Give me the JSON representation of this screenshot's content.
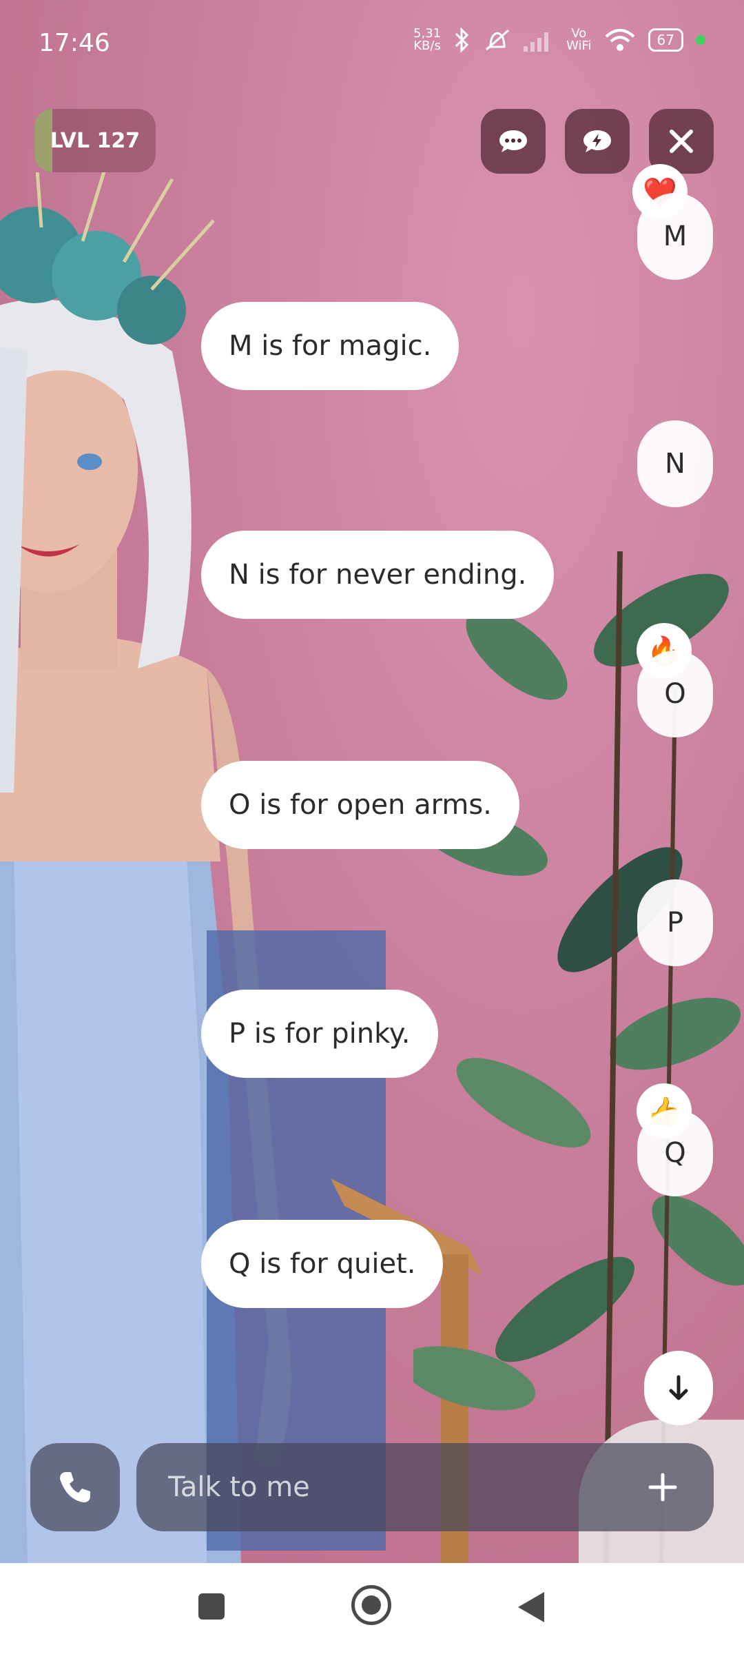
{
  "status_bar": {
    "time": "17:46",
    "speed_value": "5,31",
    "speed_unit": "KB/s",
    "vowifi_top": "Vo",
    "vowifi_bottom": "WiFi",
    "battery": "67"
  },
  "header": {
    "level_label": "LVL 127"
  },
  "chat": {
    "user_messages": [
      "M",
      "N",
      "O",
      "P",
      "Q"
    ],
    "bot_messages": [
      "M is for magic.",
      "N is for never ending.",
      "O is for open arms.",
      "P is for pinky.",
      "Q is for quiet."
    ],
    "reactions": {
      "m": "❤️",
      "o": "🔥",
      "q": "👍"
    }
  },
  "composer": {
    "placeholder": "Talk to me"
  },
  "colors": {
    "background": "#c77e98",
    "bubble": "#ffffff",
    "control_dark": "#522834",
    "input_bg": "#464658"
  }
}
